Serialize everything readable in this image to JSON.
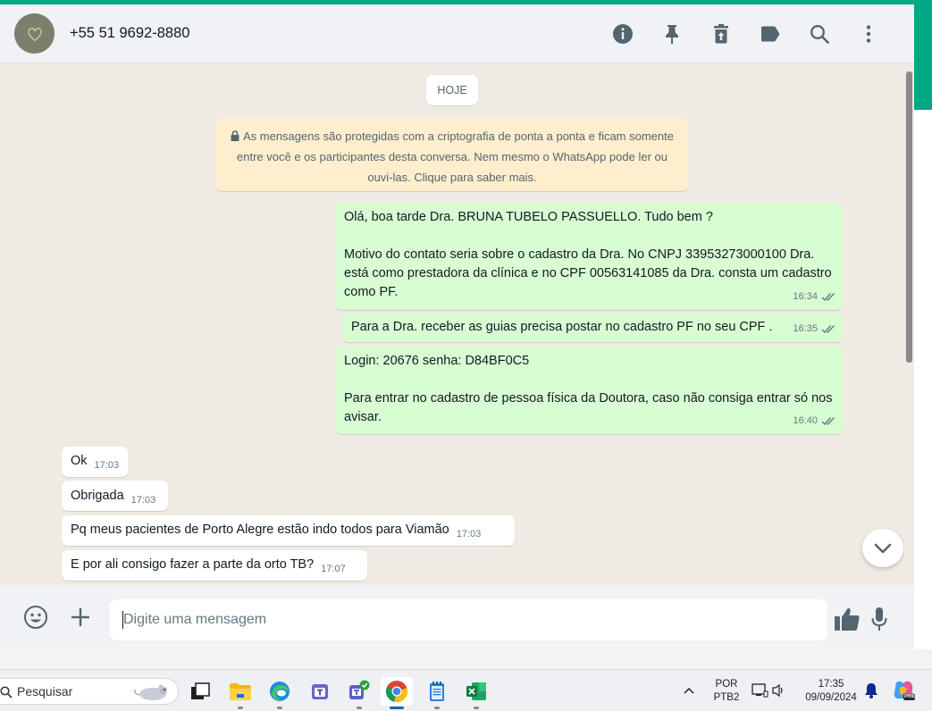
{
  "header": {
    "contact_name": "+55 51 9692-8880",
    "icons": [
      "info-icon",
      "pin-icon",
      "delete-icon",
      "label-icon",
      "search-icon",
      "menu-icon"
    ]
  },
  "chat": {
    "date_chip": "HOJE",
    "encryption_notice": "As mensagens são protegidas com a criptografia de ponta a ponta e ficam somente entre você e os participantes desta conversa. Nem mesmo o WhatsApp pode ler ou ouvi-las. Clique para saber mais.",
    "messages": [
      {
        "direction": "out",
        "text": "Olá, boa tarde Dra. BRUNA TUBELO PASSUELLO. Tudo bem ?\n\nMotivo do contato seria sobre o cadastro da Dra. No CNPJ 33953273000100 Dra. está como prestadora da clínica e no CPF 00563141085 da Dra. consta um cadastro como PF.",
        "time": "16:34",
        "status": "read"
      },
      {
        "direction": "out",
        "text": "Para a Dra. receber as guias precisa postar no cadastro PF no seu CPF .",
        "time": "16:35",
        "status": "read"
      },
      {
        "direction": "out",
        "text": "Login: 20676 senha: D84BF0C5\n\nPara entrar no cadastro de pessoa física da Doutora, caso não consiga entrar só nos avisar.",
        "time": "16:40",
        "status": "read"
      },
      {
        "direction": "in",
        "text": "Ok",
        "time": "17:03"
      },
      {
        "direction": "in",
        "text": "Obrigada",
        "time": "17:03"
      },
      {
        "direction": "in",
        "text": "Pq meus pacientes de Porto Alegre estão indo todos para Viamão",
        "time": "17:03"
      },
      {
        "direction": "in",
        "text": "E por ali consigo fazer a parte da orto TB?",
        "time": "17:07"
      }
    ]
  },
  "composer": {
    "placeholder": "Digite uma mensagem"
  },
  "taskbar": {
    "search_label": "Pesquisar",
    "language_line1": "POR",
    "language_line2": "PTB2",
    "time": "17:35",
    "date": "09/09/2024",
    "copilot_badge": "PRE"
  },
  "colors": {
    "accent": "#00a884",
    "outgoing_bubble": "#d9fdd3",
    "incoming_bubble": "#ffffff",
    "notice_bg": "#ffeecd",
    "read_tick": "#667781"
  }
}
